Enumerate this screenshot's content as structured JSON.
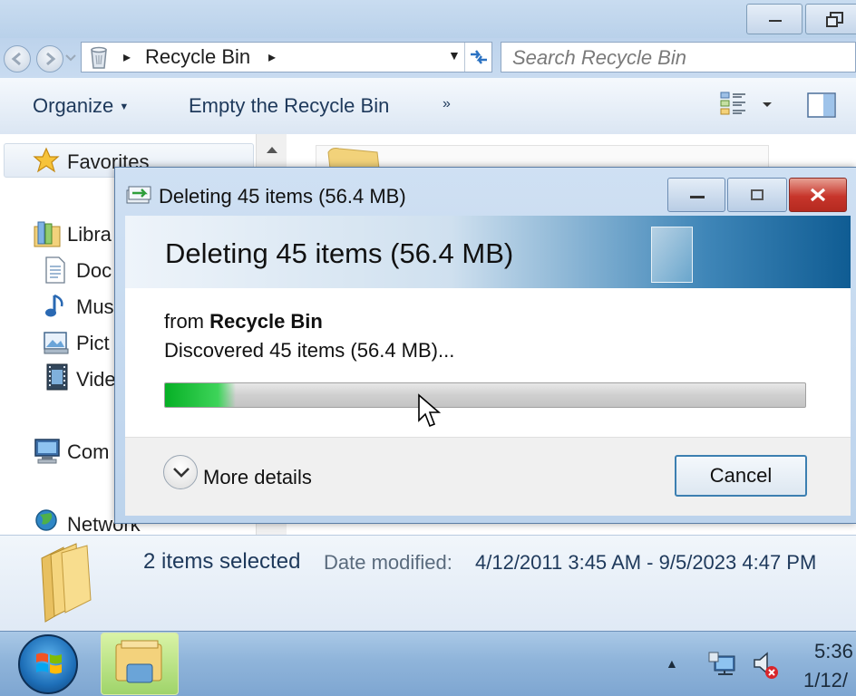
{
  "explorer": {
    "address": {
      "location": "Recycle Bin"
    },
    "search": {
      "placeholder": "Search Recycle Bin"
    },
    "toolbar": {
      "organize": "Organize",
      "empty": "Empty the Recycle Bin",
      "more": "»"
    },
    "nav": {
      "favorites": "Favorites",
      "libraries": "Libra",
      "documents": "Doc",
      "music": "Mus",
      "pictures": "Pict",
      "videos": "Vide",
      "computer": "Com",
      "network": "Network"
    },
    "details": {
      "count": "2 items selected",
      "date_label": "Date modified:",
      "date_value": "4/12/2011 3:45 AM - 9/5/2023 4:47 PM"
    }
  },
  "dialog": {
    "title": "Deleting 45 items (56.4 MB)",
    "heading": "Deleting 45 items (56.4 MB)",
    "from_prefix": "from",
    "from_location": "Recycle Bin",
    "status": "Discovered 45 items (56.4 MB)...",
    "progress": 0.11,
    "more_details": "More details",
    "cancel": "Cancel"
  },
  "taskbar": {
    "time": "5:36",
    "date": "1/12/"
  },
  "colors": {
    "progress": "#06b025",
    "close": "#c7352b"
  }
}
